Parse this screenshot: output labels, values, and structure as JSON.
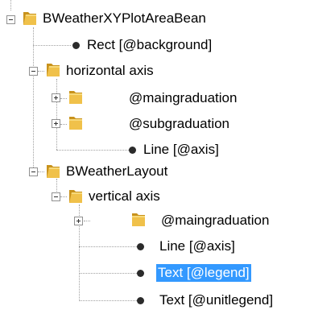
{
  "tree": {
    "root": {
      "label": "BWeatherXYPlotAreaBean",
      "icon": "folder-open-icon",
      "expanded": true,
      "children": [
        {
          "label": "Rect [@background]",
          "icon": "bullet-icon"
        },
        {
          "label": "horizontal axis",
          "icon": "folder-open-icon",
          "expanded": true,
          "children": [
            {
              "label": "@maingraduation",
              "icon": "folder-closed-icon",
              "expanded": false
            },
            {
              "label": "@subgraduation",
              "icon": "folder-closed-icon",
              "expanded": false
            },
            {
              "label": "Line [@axis]",
              "icon": "bullet-icon"
            }
          ]
        },
        {
          "label": "BWeatherLayout",
          "icon": "folder-open-icon",
          "expanded": true,
          "children": [
            {
              "label": "vertical axis",
              "icon": "folder-open-icon",
              "expanded": true,
              "children": [
                {
                  "label": "@maingraduation",
                  "icon": "folder-closed-icon",
                  "expanded": false
                },
                {
                  "label": "Line [@axis]",
                  "icon": "bullet-icon"
                },
                {
                  "label": "Text [@legend]",
                  "icon": "bullet-icon",
                  "selected": true
                },
                {
                  "label": "Text [@unitlegend]",
                  "icon": "bullet-icon"
                }
              ]
            }
          ]
        }
      ]
    }
  },
  "colors": {
    "selection": "#3399ff",
    "selection_text": "#ffffff",
    "folder": "#f0c14a",
    "folder_dark": "#c8921c",
    "connector": "#a0a0a0"
  }
}
